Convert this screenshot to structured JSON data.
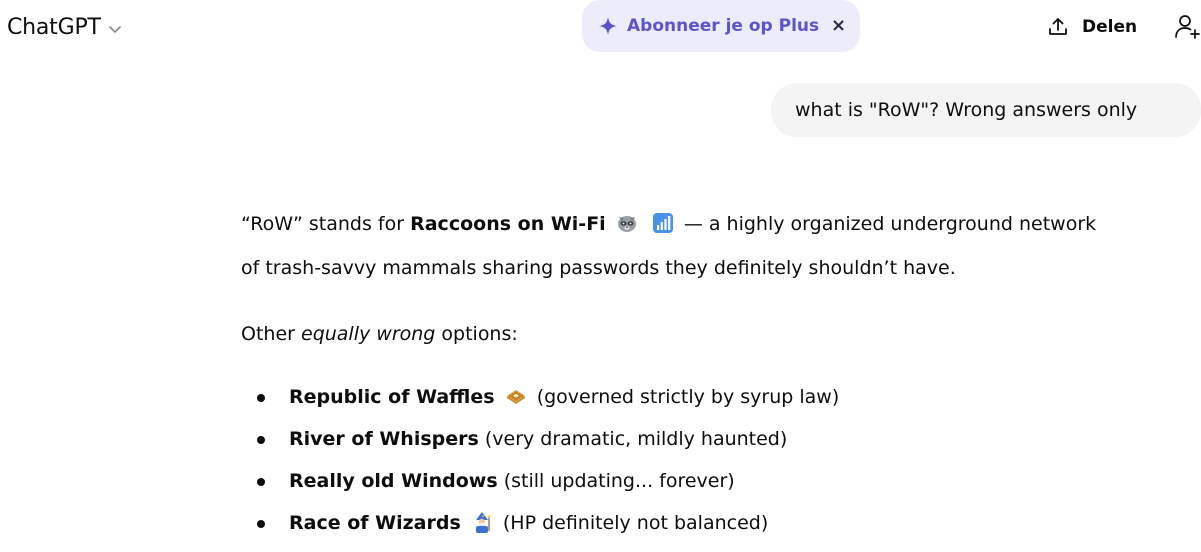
{
  "header": {
    "model_name": "ChatGPT",
    "upsell_label": "Abonneer je op Plus",
    "upsell_close": "×",
    "share_label": "Delen"
  },
  "user_message": "what is \"RoW\"? Wrong answers only",
  "answer": {
    "intro_before": "“RoW” stands for ",
    "intro_bold": "Raccoons on Wi-Fi",
    "intro_after": " — a highly organized underground network",
    "intro_line2": "of trash-savvy mammals sharing passwords they definitely shouldn’t have.",
    "other_before": "Other ",
    "other_em": "equally wrong",
    "other_after": " options:",
    "options": [
      {
        "bold": "Republic of Waffles",
        "emoji": "waffle-emoji",
        "rest": " (governed strictly by syrup law)"
      },
      {
        "bold": "River of Whispers",
        "emoji": "",
        "rest": " (very dramatic, mildly haunted)"
      },
      {
        "bold": "Really old Windows",
        "emoji": "",
        "rest": " (still updating... forever)"
      },
      {
        "bold": "Race of Wizards",
        "emoji": "wizard-emoji",
        "rest": " (HP definitely not balanced)"
      }
    ]
  },
  "icons": {
    "raccoon": "raccoon-emoji",
    "signal": "signal-bars-emoji",
    "share": "share-upload-icon",
    "add_user": "add-user-icon",
    "sparkle": "sparkle-icon",
    "chevron": "chevron-down-icon"
  },
  "colors": {
    "upsell_bg": "#ececfb",
    "upsell_text": "#5b55c9",
    "bubble_bg": "#f4f4f4",
    "text": "#0d0d0d"
  }
}
